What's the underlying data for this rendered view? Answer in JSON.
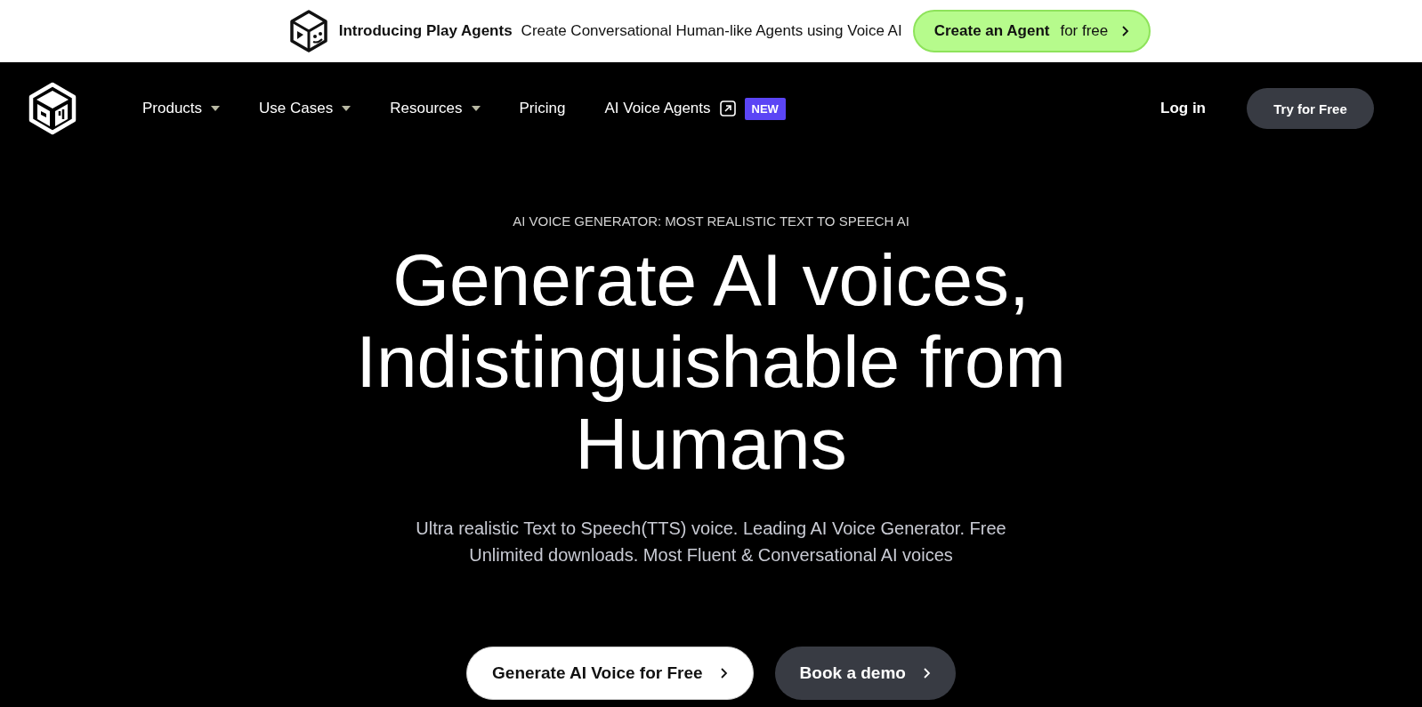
{
  "announcement": {
    "title": "Introducing Play Agents",
    "text": "Create Conversational Human-like Agents using Voice AI",
    "button": {
      "label": "Create an Agent",
      "suffix": "for free"
    }
  },
  "nav": {
    "items": [
      {
        "label": "Products",
        "dropdown": true,
        "external": false
      },
      {
        "label": "Use Cases",
        "dropdown": true,
        "external": false
      },
      {
        "label": "Resources",
        "dropdown": true,
        "external": false
      },
      {
        "label": "Pricing",
        "dropdown": false,
        "external": false
      },
      {
        "label": "AI Voice Agents",
        "dropdown": false,
        "external": true,
        "badge": "NEW"
      }
    ],
    "login": "Log in",
    "cta": "Try for Free"
  },
  "hero": {
    "eyebrow": "AI VOICE GENERATOR: MOST REALISTIC TEXT TO SPEECH AI",
    "heading": [
      "Generate AI voices,",
      "Indistinguishable from",
      "Humans"
    ],
    "subtitle": "Ultra realistic Text to Speech(TTS) voice. Leading AI Voice Generator. Free Unlimited downloads. Most Fluent & Conversational AI voices",
    "buttons": [
      {
        "label": "Generate AI Voice for Free",
        "kind": "primary"
      },
      {
        "label": "Book a demo",
        "kind": "secondary"
      }
    ]
  }
}
